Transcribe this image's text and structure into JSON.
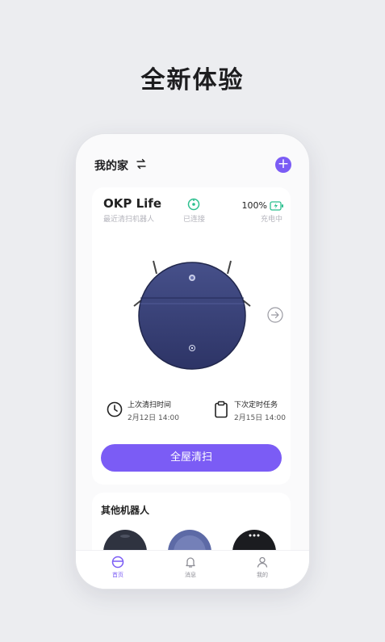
{
  "headline": "全新体验",
  "header": {
    "title": "我的家",
    "switch_icon": "swap-icon",
    "add_icon": "plus-icon",
    "add_label": "+"
  },
  "device": {
    "name": "OKP Life",
    "subtitle": "最近清扫机器人",
    "status": "已连接",
    "battery": "100%",
    "battery_status": "充电中",
    "accent": "#7b5cf5",
    "status_color": "#2bbf8e"
  },
  "last_clean": {
    "label": "上次清扫时间",
    "value": "2月12日 14:00",
    "icon": "clock-icon"
  },
  "next_task": {
    "label": "下次定时任务",
    "value": "2月15日 14:00",
    "icon": "clipboard-icon"
  },
  "clean_button": "全屋清扫",
  "others_title": "其他机器人",
  "tabs": [
    {
      "label": "首页",
      "icon": "robot-home-icon",
      "active": true
    },
    {
      "label": "消息",
      "icon": "bell-icon",
      "active": false
    },
    {
      "label": "我的",
      "icon": "user-icon",
      "active": false
    }
  ]
}
